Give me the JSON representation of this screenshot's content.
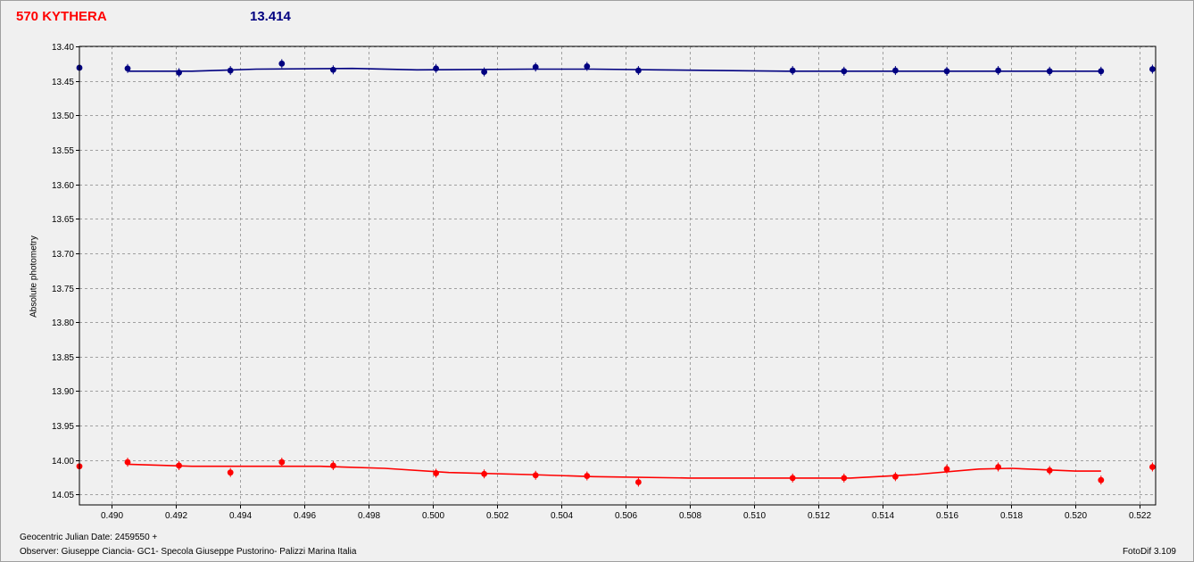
{
  "header": {
    "object_name": "570 KYTHERA",
    "magnitude": "13.414"
  },
  "footer": {
    "julian_date": "Geocentric Julian Date: 2459550 +",
    "observer": "Observer: Giuseppe Ciancia- GC1- Specola Giuseppe Pustorino- Palizzi Marina Italia",
    "software": "FotoDif 3.109"
  },
  "colors": {
    "series_blue": "#000080",
    "series_red": "#ff0000",
    "grid": "#a0a0a0"
  },
  "chart_data": {
    "type": "scatter",
    "ylabel": "Absolute photometry",
    "xlim": [
      0.489,
      0.5225
    ],
    "ylim": [
      13.4,
      14.065
    ],
    "y_inverted": true,
    "grid": true,
    "x_ticks": [
      "0.490",
      "0.492",
      "0.494",
      "0.496",
      "0.498",
      "0.500",
      "0.502",
      "0.504",
      "0.506",
      "0.508",
      "0.510",
      "0.512",
      "0.514",
      "0.516",
      "0.518",
      "0.520",
      "0.522"
    ],
    "y_ticks": [
      "13.40",
      "13.45",
      "13.50",
      "13.55",
      "13.60",
      "13.65",
      "13.70",
      "13.75",
      "13.80",
      "13.85",
      "13.90",
      "13.95",
      "14.00",
      "14.05"
    ],
    "series": [
      {
        "color": "#000080",
        "points": [
          [
            0.489,
            13.431
          ],
          [
            0.4905,
            13.432
          ],
          [
            0.4921,
            13.438
          ],
          [
            0.4937,
            13.435
          ],
          [
            0.4953,
            13.425
          ],
          [
            0.4969,
            13.434
          ],
          [
            0.5001,
            13.432
          ],
          [
            0.5016,
            13.437
          ],
          [
            0.5032,
            13.43
          ],
          [
            0.5048,
            13.429
          ],
          [
            0.5064,
            13.435
          ],
          [
            0.5112,
            13.435
          ],
          [
            0.5128,
            13.436
          ],
          [
            0.5144,
            13.435
          ],
          [
            0.516,
            13.436
          ],
          [
            0.5176,
            13.435
          ],
          [
            0.5192,
            13.436
          ],
          [
            0.5208,
            13.436
          ],
          [
            0.5224,
            13.433
          ]
        ],
        "fit": [
          [
            0.4905,
            13.436
          ],
          [
            0.4925,
            13.436
          ],
          [
            0.4945,
            13.433
          ],
          [
            0.4975,
            13.432
          ],
          [
            0.4995,
            13.434
          ],
          [
            0.503,
            13.433
          ],
          [
            0.505,
            13.433
          ],
          [
            0.507,
            13.434
          ],
          [
            0.509,
            13.435
          ],
          [
            0.511,
            13.436
          ],
          [
            0.515,
            13.436
          ],
          [
            0.5208,
            13.436
          ]
        ]
      },
      {
        "color": "#ff0000",
        "points": [
          [
            0.489,
            14.009
          ],
          [
            0.4905,
            14.003
          ],
          [
            0.4921,
            14.008
          ],
          [
            0.4937,
            14.018
          ],
          [
            0.4953,
            14.003
          ],
          [
            0.4969,
            14.008
          ],
          [
            0.5001,
            14.019
          ],
          [
            0.5016,
            14.02
          ],
          [
            0.5032,
            14.022
          ],
          [
            0.5048,
            14.023
          ],
          [
            0.5064,
            14.032
          ],
          [
            0.5112,
            14.026
          ],
          [
            0.5128,
            14.026
          ],
          [
            0.5144,
            14.024
          ],
          [
            0.516,
            14.013
          ],
          [
            0.5176,
            14.01
          ],
          [
            0.5192,
            14.015
          ],
          [
            0.5208,
            14.029
          ],
          [
            0.5224,
            14.01
          ]
        ],
        "fit": [
          [
            0.4905,
            14.006
          ],
          [
            0.4925,
            14.009
          ],
          [
            0.4965,
            14.009
          ],
          [
            0.4985,
            14.012
          ],
          [
            0.5005,
            14.018
          ],
          [
            0.503,
            14.021
          ],
          [
            0.505,
            14.024
          ],
          [
            0.508,
            14.026
          ],
          [
            0.513,
            14.026
          ],
          [
            0.515,
            14.021
          ],
          [
            0.517,
            14.013
          ],
          [
            0.518,
            14.012
          ],
          [
            0.52,
            14.016
          ],
          [
            0.5208,
            14.016
          ]
        ]
      }
    ]
  }
}
